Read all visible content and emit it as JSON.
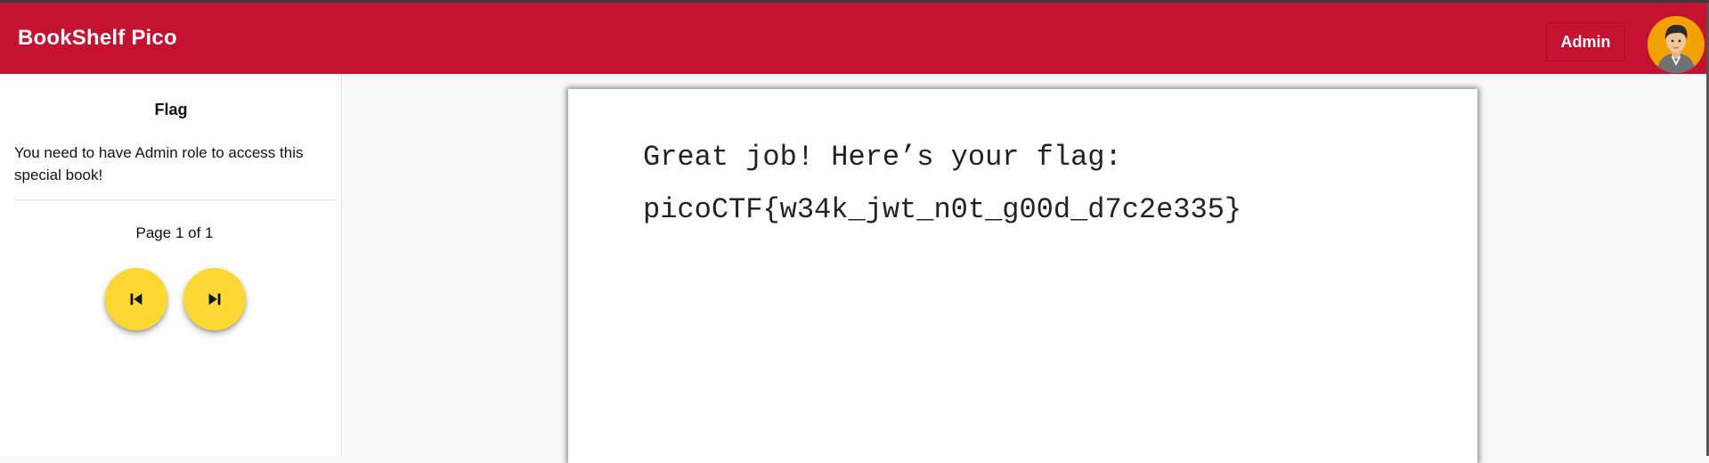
{
  "header": {
    "brand": "BookShelf Pico",
    "role_label": "Admin",
    "accent_color": "#c41230"
  },
  "sidebar": {
    "title": "Flag",
    "description": "You need to have Admin role to access this special book!",
    "page_indicator": "Page 1 of 1",
    "prev_icon": "skip-previous-icon",
    "next_icon": "skip-next-icon",
    "fab_color": "#fdd835"
  },
  "page": {
    "line1": "Great job! Here’s your flag:",
    "line2": "picoCTF{w34k_jwt_n0t_g00d_d7c2e335}"
  }
}
